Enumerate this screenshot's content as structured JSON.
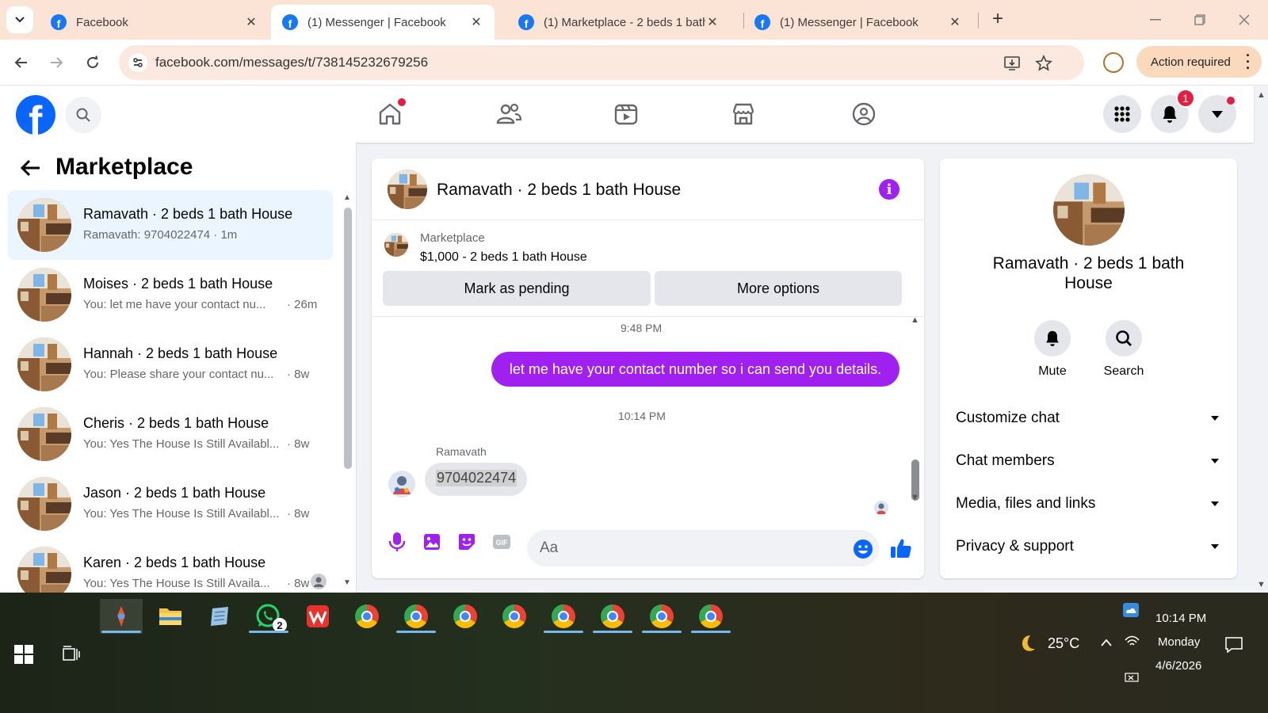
{
  "browser": {
    "tabs": [
      {
        "title": "Facebook",
        "active": false
      },
      {
        "title": "(1) Messenger | Facebook",
        "active": true
      },
      {
        "title": "(1) Marketplace - 2 beds 1 bath",
        "active": false
      },
      {
        "title": "(1) Messenger | Facebook",
        "active": false
      }
    ],
    "url": "facebook.com/messages/t/738145232679256",
    "action_required": "Action required"
  },
  "fb": {
    "logo": "f",
    "notification_count": "1"
  },
  "left_panel": {
    "title": "Marketplace",
    "conversations": [
      {
        "name": "Ramavath · 2 beds 1 bath House",
        "preview": "Ramavath: 9704022474 · 1m",
        "time": ""
      },
      {
        "name": "Moises · 2 beds 1 bath House",
        "preview": "You: let me have your contact nu...",
        "time": "· 26m"
      },
      {
        "name": "Hannah · 2 beds 1 bath House",
        "preview": "You: Please share your contact nu...",
        "time": "· 8w"
      },
      {
        "name": "Cheris · 2 beds 1 bath House",
        "preview": "You: Yes The House Is Still Availabl...",
        "time": "· 8w"
      },
      {
        "name": "Jason · 2 beds 1 bath House",
        "preview": "You: Yes The House Is Still Availabl...",
        "time": "· 8w"
      },
      {
        "name": "Karen · 2 beds 1 bath House",
        "preview": "You: Yes The House Is Still Availa...",
        "time": "· 8w"
      }
    ]
  },
  "chat": {
    "title": "Ramavath · 2 beds 1 bath House",
    "marketplace_label": "Marketplace",
    "listing": "$1,000 - 2 beds 1 bath House",
    "mark_pending": "Mark as pending",
    "more_options": "More options",
    "ts1": "9:48 PM",
    "outgoing": "let me have your contact number so i can send you details.",
    "ts2": "10:14 PM",
    "sender": "Ramavath",
    "incoming": "9704022474",
    "input_placeholder": "Aa"
  },
  "right_panel": {
    "name": "Ramavath · 2 beds 1 bath House",
    "mute": "Mute",
    "search": "Search",
    "sections": [
      "Customize chat",
      "Chat members",
      "Media, files and links",
      "Privacy & support"
    ]
  },
  "taskbar": {
    "whatsapp_badge": "2",
    "weather": "25°C",
    "time": "10:14 PM",
    "day": "Monday",
    "date": "4/6/2026"
  },
  "colors": {
    "fb_blue": "#0866ff",
    "messenger_purple": "#a020f0",
    "tab_bg": "#fbe3d6"
  }
}
